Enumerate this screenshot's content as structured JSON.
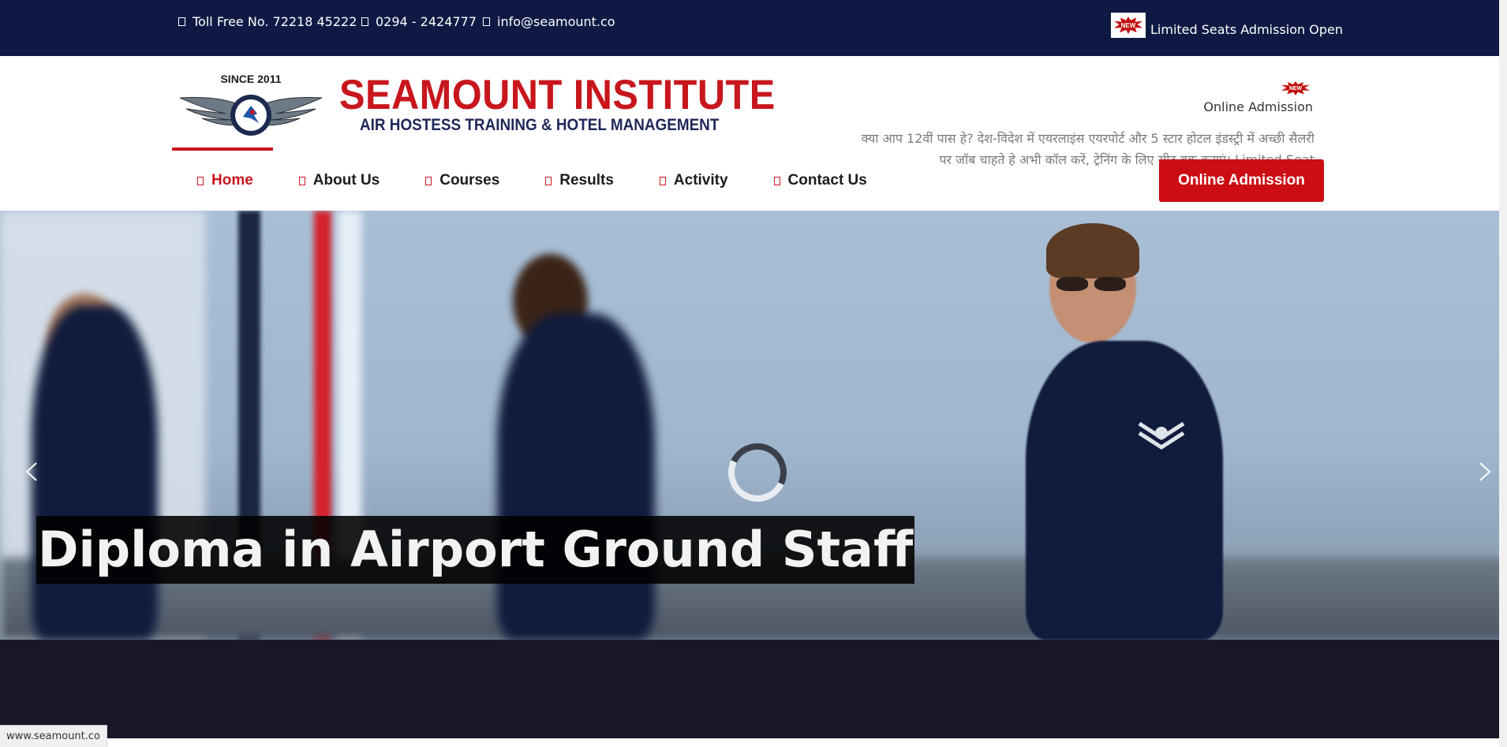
{
  "topbar": {
    "tollfree": "Toll Free No. 72218 45222",
    "phone": "0294 - 2424777",
    "email": "info@seamount.co",
    "new_badge": "NEW",
    "seats": "Limited Seats Admission Open"
  },
  "brand": {
    "since": "SINCE 2011",
    "name": "SEAMOUNT INSTITUTE",
    "tagline": "AIR HOSTESS TRAINING & HOTEL MANAGEMENT"
  },
  "header": {
    "online_admission_link": "Online Admission",
    "new_badge": "NEW",
    "marquee": "क्या आप 12वीं पास हे? देश-विदेश में एयरलाइंस एयरपोर्ट और 5 स्टार होटल इंडस्ट्री में अच्छी सैलरी पर जॉब चाहते हे अभी कॉल करें, ट्रेनिंग के लिए सीट बुक कराएं। Limited Seat"
  },
  "nav": {
    "items": [
      {
        "label": "Home",
        "active": true
      },
      {
        "label": "About Us"
      },
      {
        "label": "Courses"
      },
      {
        "label": "Results"
      },
      {
        "label": "Activity"
      },
      {
        "label": "Contact Us"
      }
    ],
    "cta": "Online Admission"
  },
  "hero": {
    "caption": "Diploma in Airport Ground Staff"
  },
  "status": {
    "url": "www.seamount.co"
  },
  "colors": {
    "topbar": "#0f1a44",
    "brand_red": "#c8161d",
    "brand_navy": "#1f2858",
    "cta": "#cc0d14"
  }
}
